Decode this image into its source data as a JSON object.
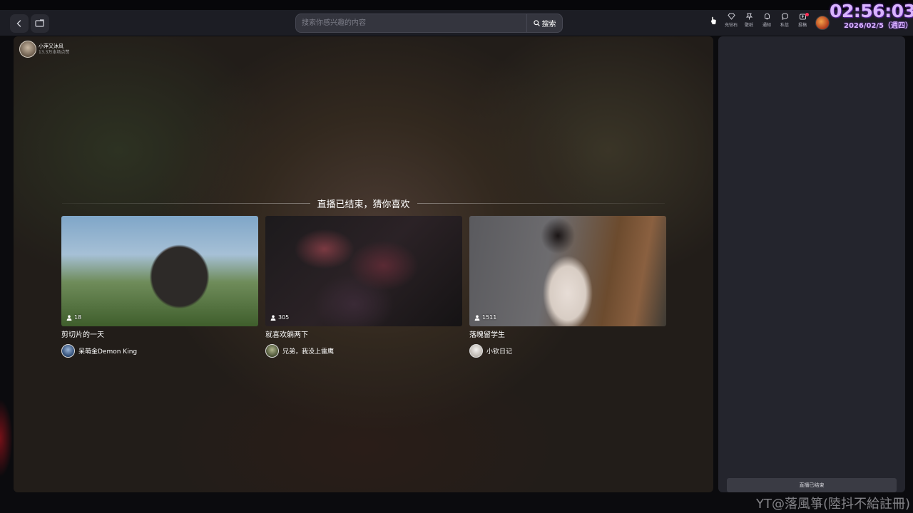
{
  "header": {
    "search_placeholder": "搜索你感兴趣的内容",
    "search_button": "搜索",
    "icons": [
      {
        "name": "diamond-icon",
        "label": "充钻石",
        "badge": false
      },
      {
        "name": "wallpaper-icon",
        "label": "壁纸",
        "badge": false
      },
      {
        "name": "bell-icon",
        "label": "通知",
        "badge": false
      },
      {
        "name": "message-icon",
        "label": "私信",
        "badge": false
      },
      {
        "name": "upload-icon",
        "label": "投稿",
        "badge": true
      }
    ]
  },
  "overlay_clock": {
    "time": "02:56:03",
    "date": "2026/02/5（週四）"
  },
  "streamer": {
    "name": "小萍又沐风",
    "likes": "13.3万本场点赞"
  },
  "section_title": "直播已结束，猜你喜欢",
  "recommendations": [
    {
      "viewers": "18",
      "title": "剪切片的一天",
      "author": "呆萌金Demon King"
    },
    {
      "viewers": "305",
      "title": "就喜欢躺两下",
      "author": "兄弟，我没上雷鹰"
    },
    {
      "viewers": "1511",
      "title": "落魄留学生",
      "author": "小钦日记"
    }
  ],
  "side_panel": {
    "ended_label": "直播已结束"
  },
  "watermark": "YT@落風箏(陸抖不給註冊)",
  "colors": {
    "accent_red": "#fe2c55",
    "clock_purple": "#d9b3ff",
    "header_bg": "#1c1d24",
    "panel_bg": "#24252d"
  }
}
